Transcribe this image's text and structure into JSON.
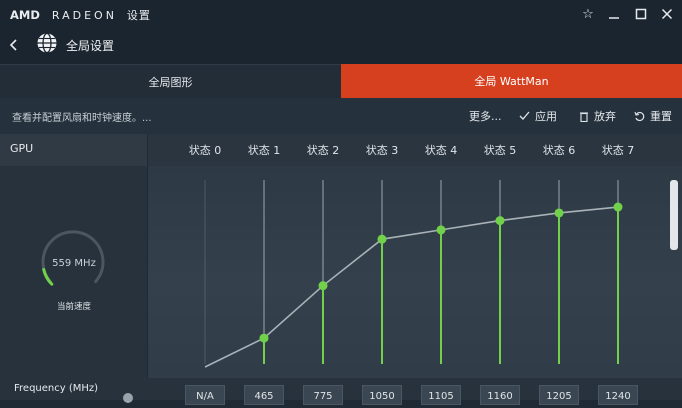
{
  "app": {
    "brand_amd": "AMD",
    "brand_radeon": "RADEON",
    "brand_settings": "设置",
    "page_title": "全局设置"
  },
  "icons": {
    "star": "star-icon",
    "minimize": "minimize-icon",
    "maximize": "maximize-icon",
    "close": "close-icon",
    "back": "chevron-left-icon",
    "globe": "globe-icon"
  },
  "tabs": [
    {
      "label": "全局图形",
      "active": false
    },
    {
      "label": "全局 WattMan",
      "active": true
    }
  ],
  "actionbar": {
    "hint": "查看并配置风扇和时钟速度。...",
    "more": "更多...",
    "apply": "应用",
    "discard": "放弃",
    "reset": "重置"
  },
  "gpu": {
    "label": "GPU",
    "states": [
      "状态 0",
      "状态 1",
      "状态 2",
      "状态 3",
      "状态 4",
      "状态 5",
      "状态 6",
      "状态 7"
    ],
    "gauge_value": "559 MHz",
    "gauge_caption": "当前速度",
    "frequency_label": "Frequency (MHz)",
    "frequencies": [
      "N/A",
      "465",
      "775",
      "1050",
      "1105",
      "1160",
      "1205",
      "1240"
    ]
  },
  "colors": {
    "accent": "#d6401f",
    "state_active": "#71d14a",
    "background": "#1f2a35"
  },
  "chart_data": {
    "type": "line",
    "categories": [
      "状态 0",
      "状态 1",
      "状态 2",
      "状态 3",
      "状态 4",
      "状态 5",
      "状态 6",
      "状态 7"
    ],
    "values": [
      null,
      465,
      775,
      1050,
      1105,
      1160,
      1205,
      1240
    ],
    "title": "",
    "xlabel": "",
    "ylabel": "",
    "ylim": [
      300,
      1400
    ]
  }
}
